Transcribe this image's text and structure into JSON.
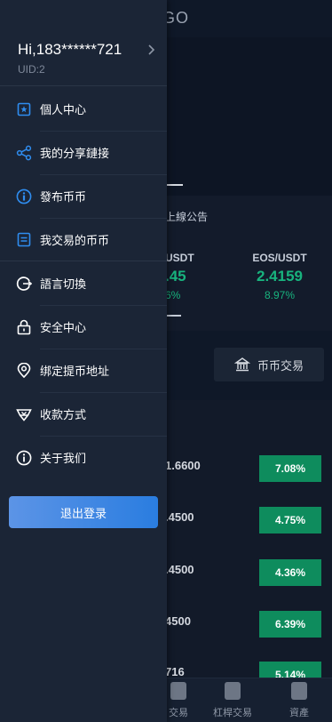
{
  "background": {
    "title": "GO",
    "notice": "上線公告",
    "ticker_left": {
      "pair": "USDT",
      "price": ".45",
      "change": "6%"
    },
    "ticker_right": {
      "pair": "EOS/USDT",
      "price": "2.4159",
      "change": "8.97%"
    },
    "trade_button": "币币交易",
    "rows": [
      {
        "price": "1.6600",
        "change": "7.08%"
      },
      {
        "price": ".4500",
        "change": "4.75%"
      },
      {
        "price": ".4500",
        "change": "4.36%"
      },
      {
        "price": "4500",
        "change": "6.39%"
      },
      {
        "price": "716",
        "change": "5.14%"
      }
    ],
    "tabs": [
      {
        "label": "交易",
        "icon": "exchange-icon"
      },
      {
        "label": "杠桿交易",
        "icon": "leverage-icon"
      },
      {
        "label": "資產",
        "icon": "wallet-icon"
      }
    ]
  },
  "drawer": {
    "greeting": "Hi,183******721",
    "uid": "UID:2",
    "menu": [
      {
        "label": "個人中心",
        "icon": "star-badge-icon"
      },
      {
        "label": "我的分享鏈接",
        "icon": "share-icon"
      },
      {
        "label": "發布币币",
        "icon": "info-circle-icon"
      },
      {
        "label": "我交易的币币",
        "icon": "document-icon"
      },
      {
        "label": "語言切換",
        "icon": "language-switch-icon"
      },
      {
        "label": "安全中心",
        "icon": "lock-icon"
      },
      {
        "label": "绑定提币地址",
        "icon": "location-pin-icon"
      },
      {
        "label": "收款方式",
        "icon": "payment-icon"
      },
      {
        "label": "关于我们",
        "icon": "info-icon"
      }
    ],
    "logout_label": "退出登录"
  },
  "colors": {
    "accent": "#2a7de0",
    "up_green": "#0e8c5d",
    "drawer_bg": "#1b2536"
  }
}
